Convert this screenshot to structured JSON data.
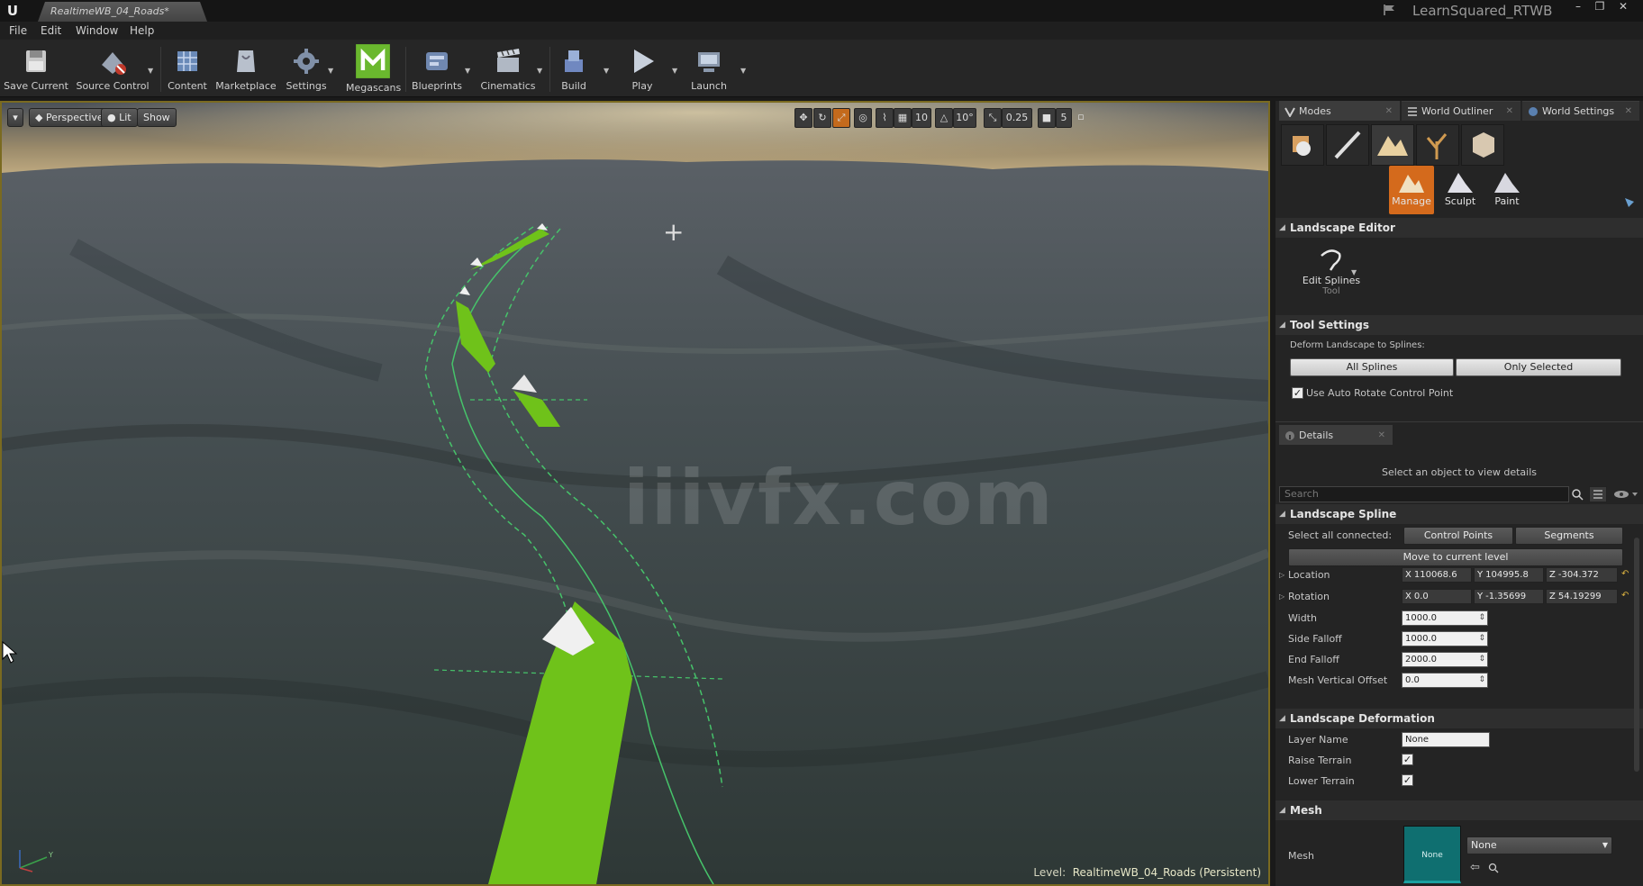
{
  "window": {
    "doc_tab": "RealtimeWB_04_Roads*",
    "project_name": "LearnSquared_RTWB",
    "controls": [
      "–",
      "❐",
      "✕"
    ]
  },
  "menu": [
    "File",
    "Edit",
    "Window",
    "Help"
  ],
  "toolbar": {
    "items": [
      {
        "label": "Save Current",
        "icon": "save-icon"
      },
      {
        "label": "Source Control",
        "icon": "source-control-icon"
      },
      {
        "label": "Content",
        "icon": "content-icon"
      },
      {
        "label": "Marketplace",
        "icon": "marketplace-icon"
      },
      {
        "label": "Settings",
        "icon": "settings-icon"
      },
      {
        "label": "Megascans",
        "icon": "megascans-icon"
      },
      {
        "label": "Blueprints",
        "icon": "blueprints-icon"
      },
      {
        "label": "Cinematics",
        "icon": "cinematics-icon"
      },
      {
        "label": "Build",
        "icon": "build-icon"
      },
      {
        "label": "Play",
        "icon": "play-icon"
      },
      {
        "label": "Launch",
        "icon": "launch-icon"
      }
    ]
  },
  "viewport": {
    "perspective_label": "Perspective",
    "lit_label": "Lit",
    "show_label": "Show",
    "grid_snap": "10",
    "rotation_snap": "10°",
    "scale_snap": "0.25",
    "camera_speed": "5",
    "watermark": "iiivfx.com",
    "level_prefix": "Level:",
    "level_name": "RealtimeWB_04_Roads (Persistent)",
    "accent_color": "#7a6a20",
    "spline_color": "#6fc21a"
  },
  "panel": {
    "tabs": [
      "Modes",
      "World Outliner",
      "World Settings"
    ],
    "landscape_modes": [
      "Manage",
      "Sculpt",
      "Paint"
    ],
    "landscape_editor": {
      "title": "Landscape Editor",
      "tool_label": "Edit Splines",
      "tool_sub": "Tool"
    },
    "tool_settings": {
      "title": "Tool Settings",
      "deform_label": "Deform Landscape to Splines:",
      "all_splines": "All Splines",
      "only_selected": "Only Selected",
      "auto_rotate": "Use Auto Rotate Control Point"
    },
    "details": {
      "tab": "Details",
      "hint": "Select an object to view details",
      "search_placeholder": "Search"
    },
    "landscape_spline": {
      "title": "Landscape Spline",
      "select_label": "Select all connected:",
      "control_points": "Control Points",
      "segments": "Segments",
      "move_to_level": "Move to current level",
      "location_label": "Location",
      "location": {
        "x": "110068.6",
        "y": "104995.8",
        "z": "-304.372"
      },
      "rotation_label": "Rotation",
      "rotation": {
        "x": "0.0",
        "y": "-1.35699",
        "z": "54.19299"
      },
      "width_label": "Width",
      "width": "1000.0",
      "side_falloff_label": "Side Falloff",
      "side_falloff": "1000.0",
      "end_falloff_label": "End Falloff",
      "end_falloff": "2000.0",
      "mesh_offset_label": "Mesh Vertical Offset",
      "mesh_offset": "0.0"
    },
    "landscape_deformation": {
      "title": "Landscape Deformation",
      "layer_name_label": "Layer Name",
      "layer_name": "None",
      "raise_label": "Raise Terrain",
      "lower_label": "Lower Terrain"
    },
    "mesh": {
      "title": "Mesh",
      "label": "Mesh",
      "thumb_text": "None",
      "dropdown_value": "None"
    }
  }
}
